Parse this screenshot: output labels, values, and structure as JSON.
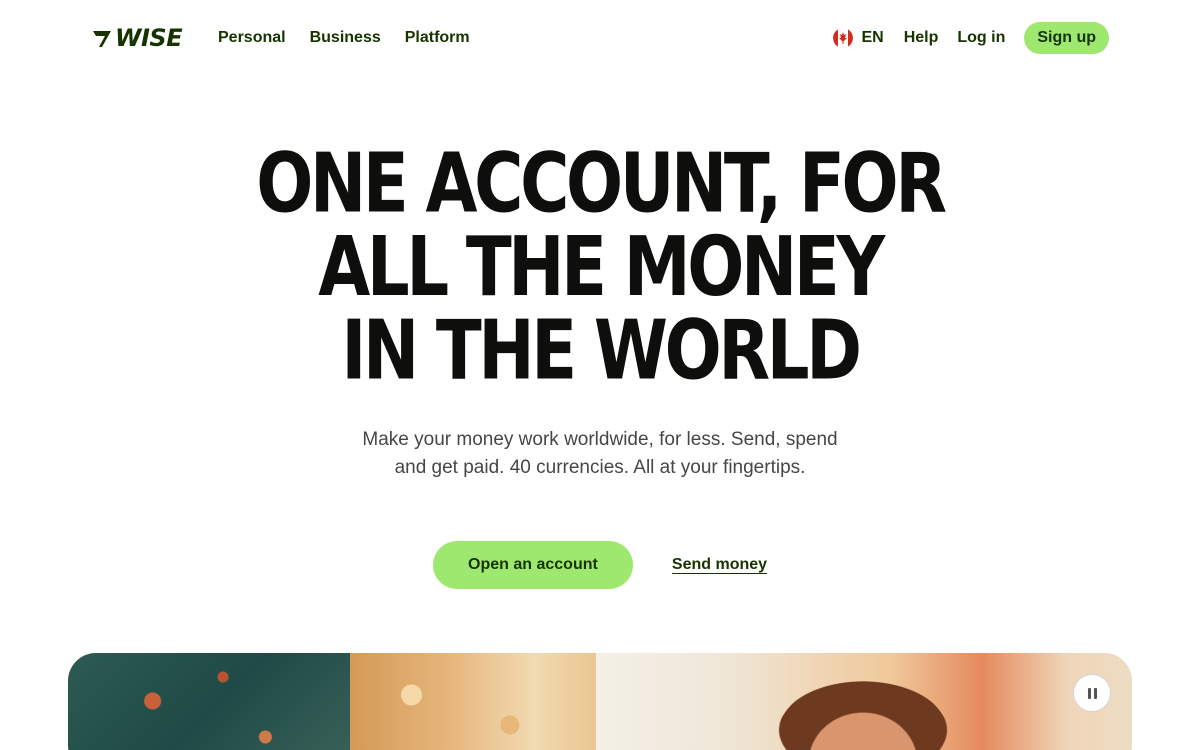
{
  "brand": {
    "name": "WISE",
    "logo_icon": "wise-flag-logo",
    "color": "#163300",
    "accent": "#9fe870"
  },
  "nav": {
    "links": [
      {
        "label": "Personal"
      },
      {
        "label": "Business"
      },
      {
        "label": "Platform"
      }
    ],
    "language": {
      "label": "EN",
      "flag_icon": "canada-flag-icon"
    },
    "help_label": "Help",
    "login_label": "Log in",
    "signup_label": "Sign up"
  },
  "hero": {
    "title_lines": [
      "ONE ACCOUNT, FOR",
      "ALL THE MONEY",
      "IN THE WORLD"
    ],
    "subtitle": "Make your money work worldwide, for less. Send, spend and get paid. 40 currencies. All at your fingertips.",
    "primary_cta": "Open an account",
    "secondary_cta": "Send money"
  },
  "media": {
    "pause_icon": "pause-icon"
  }
}
